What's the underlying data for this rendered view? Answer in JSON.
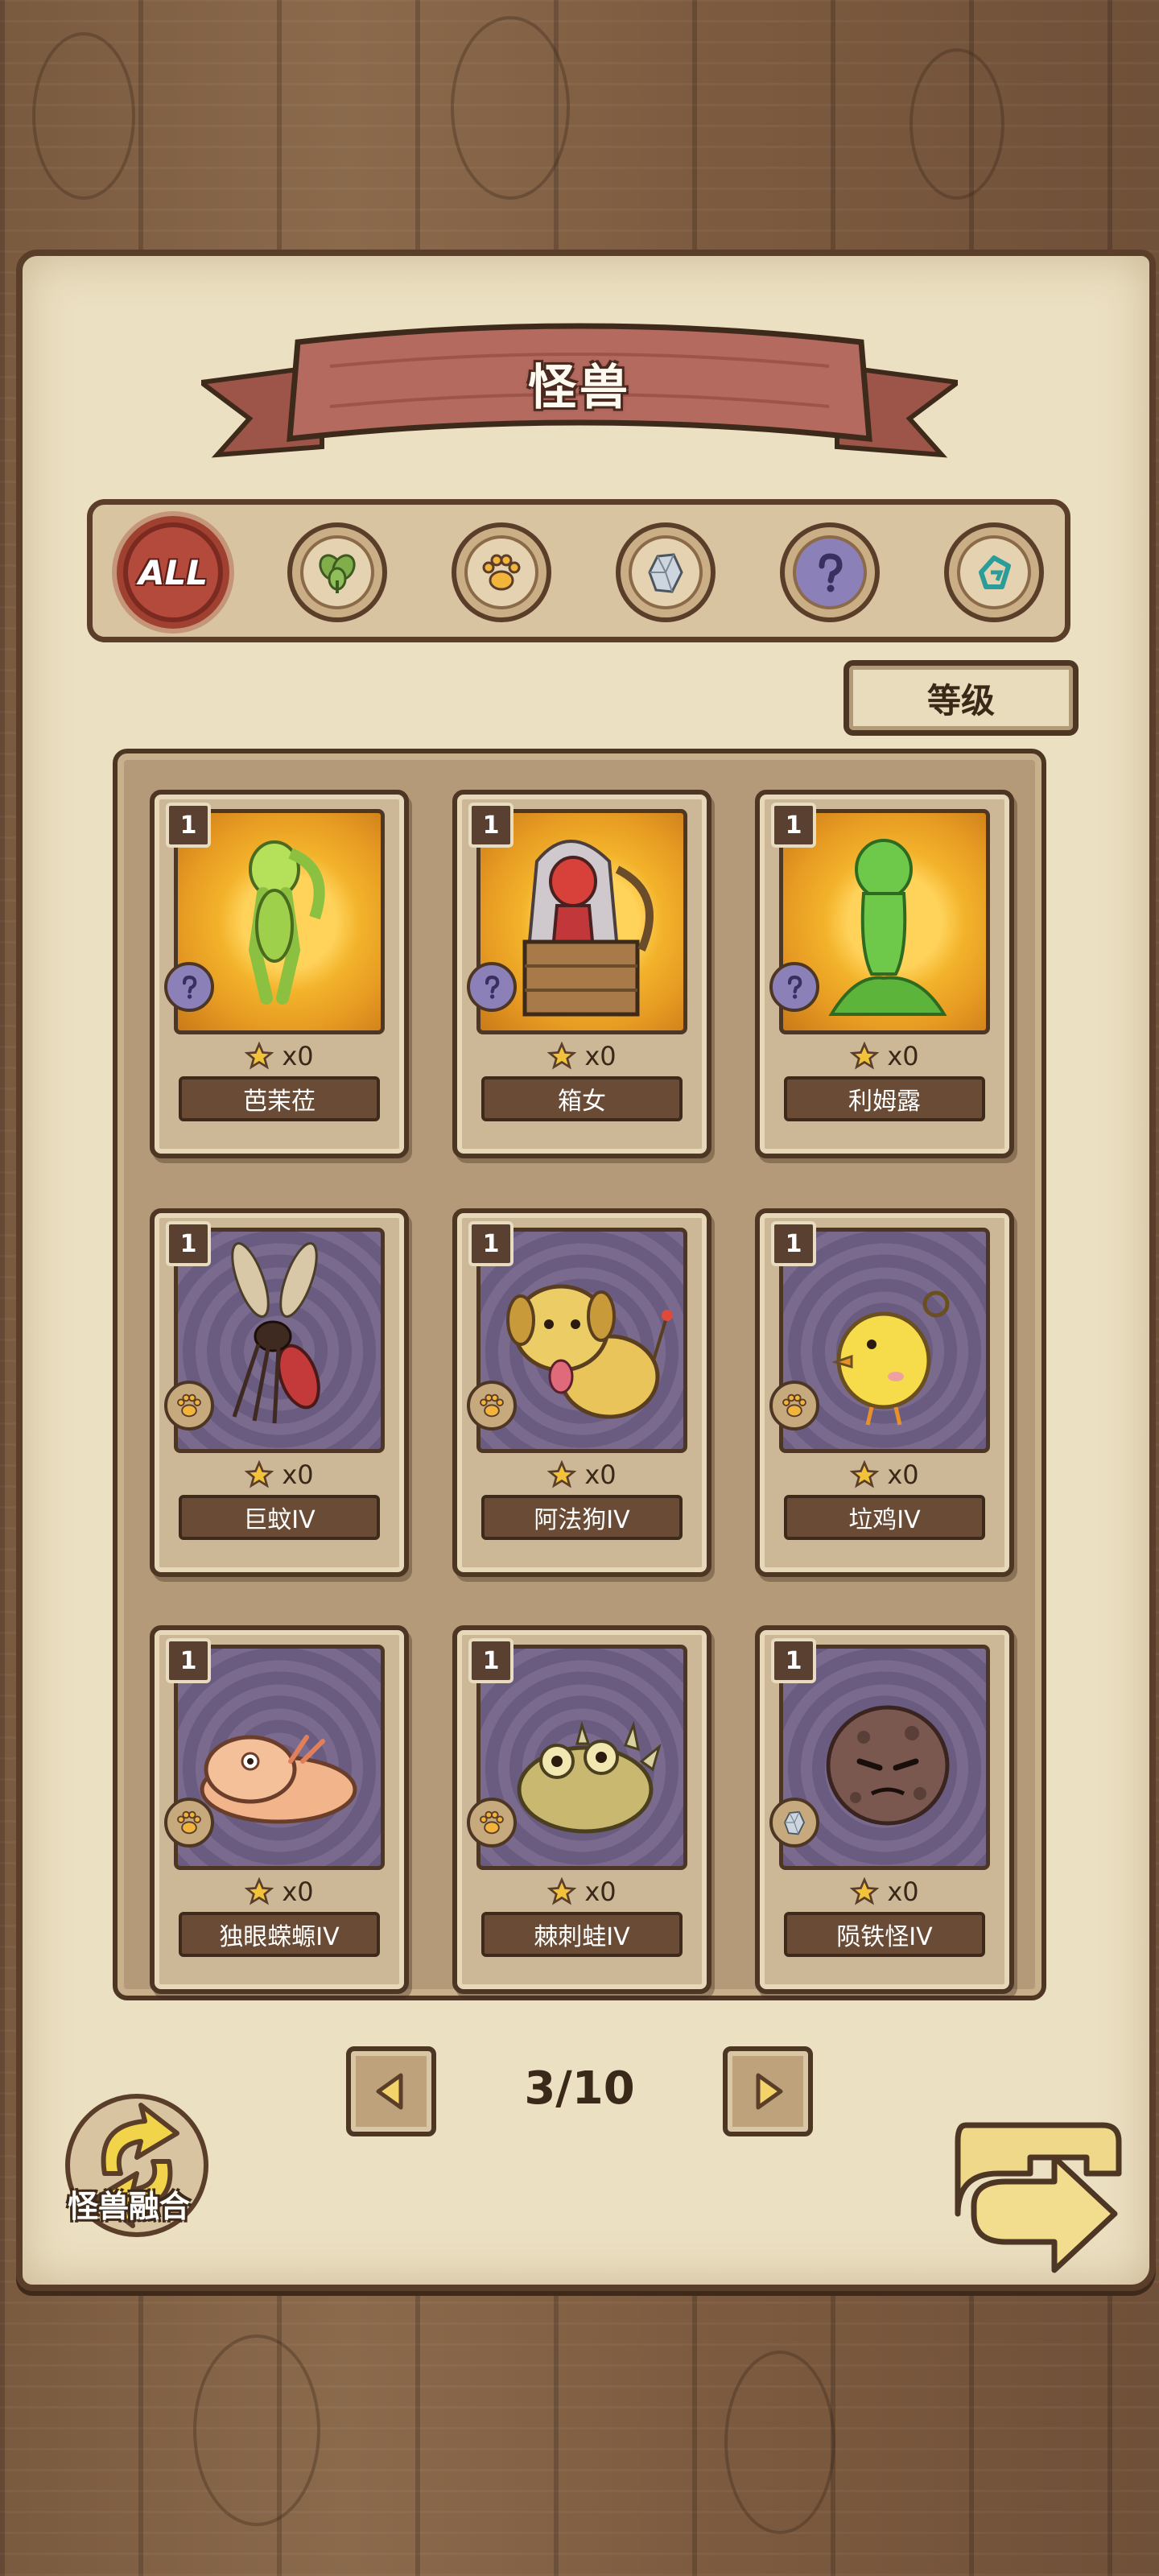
{
  "header": {
    "title": "怪兽"
  },
  "filters": [
    {
      "id": "all",
      "label": "ALL",
      "icon": "all-icon",
      "active": true
    },
    {
      "id": "plant",
      "icon": "leaf-icon",
      "active": false
    },
    {
      "id": "beast",
      "icon": "paw-icon",
      "active": false
    },
    {
      "id": "mineral",
      "icon": "crystal-icon",
      "active": false
    },
    {
      "id": "unknown",
      "icon": "question-icon",
      "active": false
    },
    {
      "id": "machine",
      "icon": "gear-icon",
      "active": false
    }
  ],
  "sort": {
    "label": "等级"
  },
  "cards": [
    {
      "level": "1",
      "count": "x0",
      "name": "芭茉莅",
      "type": "question-icon",
      "bg": "gold"
    },
    {
      "level": "1",
      "count": "x0",
      "name": "箱女",
      "type": "question-icon",
      "bg": "gold"
    },
    {
      "level": "1",
      "count": "x0",
      "name": "利姆露",
      "type": "question-icon",
      "bg": "gold"
    },
    {
      "level": "1",
      "count": "x0",
      "name": "巨蚊IV",
      "type": "paw-icon",
      "bg": "purple"
    },
    {
      "level": "1",
      "count": "x0",
      "name": "阿法狗IV",
      "type": "paw-icon",
      "bg": "purple"
    },
    {
      "level": "1",
      "count": "x0",
      "name": "垃鸡IV",
      "type": "paw-icon",
      "bg": "purple"
    },
    {
      "level": "1",
      "count": "x0",
      "name": "独眼蝾螈IV",
      "type": "paw-icon",
      "bg": "purple"
    },
    {
      "level": "1",
      "count": "x0",
      "name": "棘刺蛙IV",
      "type": "paw-icon",
      "bg": "purple"
    },
    {
      "level": "1",
      "count": "x0",
      "name": "陨铁怪IV",
      "type": "crystal-icon",
      "bg": "purple"
    }
  ],
  "pagination": {
    "label": "3/10"
  },
  "fusion": {
    "label": "怪兽融合"
  },
  "colors": {
    "gold": "#f3b32b",
    "purple": "#6a5b80",
    "banner": "#b46a5e",
    "active": "#b34a3c"
  }
}
